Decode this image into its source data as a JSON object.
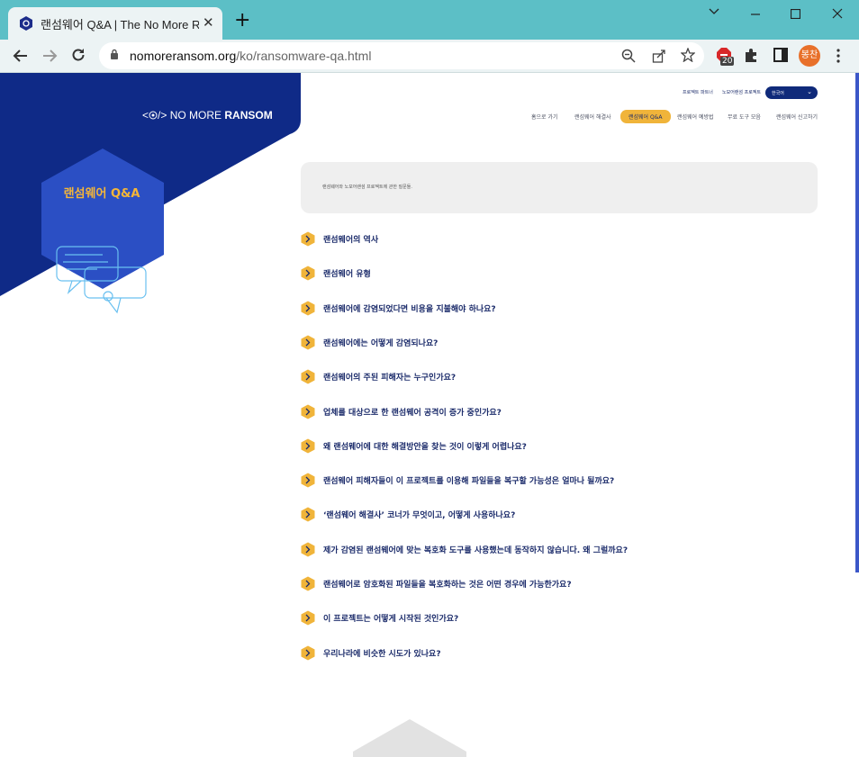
{
  "browser": {
    "tab_title": "랜섬웨어 Q&A | The No More Ransom",
    "tab_close": "✕",
    "new_tab": "+",
    "url_host": "nomoreransom.org",
    "url_path": "/ko/ransomware-qa.html",
    "extension_badge": "20",
    "profile_initials": "봉찬"
  },
  "site": {
    "logo_prefix": "<",
    "logo_suffix": "/>",
    "logo_text_regular": "NO MORE ",
    "logo_text_bold": "RANSOM",
    "hex_title": "랜섬웨어 Q&A",
    "top_links": [
      "프로젝트 파트너",
      "노모어랜섬 프로젝트"
    ],
    "language": "한국어",
    "nav": [
      "홈으로 가기",
      "랜섬웨어 해결사",
      "랜섬웨어 Q&A",
      "랜섬웨어 예방법",
      "무료 도구 모음",
      "랜섬웨어 신고하기"
    ],
    "active_nav": "랜섬웨어 Q&A",
    "notice": "랜섬웨어와 노모어랜섬 프로젝트에 관한 질문들."
  },
  "faq": [
    "랜섬웨어의 역사",
    "랜섬웨어 유형",
    "랜섬웨어에 감염되었다면 비용을 지불해야 하나요?",
    "랜섬웨어에는 어떻게 감염되나요?",
    "랜섬웨어의 주된 피해자는 누구인가요?",
    "업체를 대상으로 한 랜섬웨어 공격이 증가 중인가요?",
    "왜 랜섬웨어에 대한 해결방안을 찾는 것이 이렇게 어렵나요?",
    "랜섬웨어 피해자들이 이 프로젝트를 이용해 파일들을 복구할 가능성은 얼마나 될까요?",
    "‘랜섬웨어 해결사’ 코너가 무엇이고, 어떻게 사용하나요?",
    "제가 감염된 랜섬웨어에 맞는 복호화 도구를 사용했는데 동작하지 않습니다. 왜 그럴까요?",
    "랜섬웨어로 암호화된 파일들을 복호화하는 것은 어떤 경우에 가능한가요?",
    "이 프로젝트는 어떻게 시작된 것인가요?",
    "우리나라에 비슷한 시도가 있나요?"
  ],
  "colors": {
    "brand_blue": "#0f2a87",
    "accent_yellow": "#f0b43a",
    "hex_blue": "#2b4fc4"
  }
}
